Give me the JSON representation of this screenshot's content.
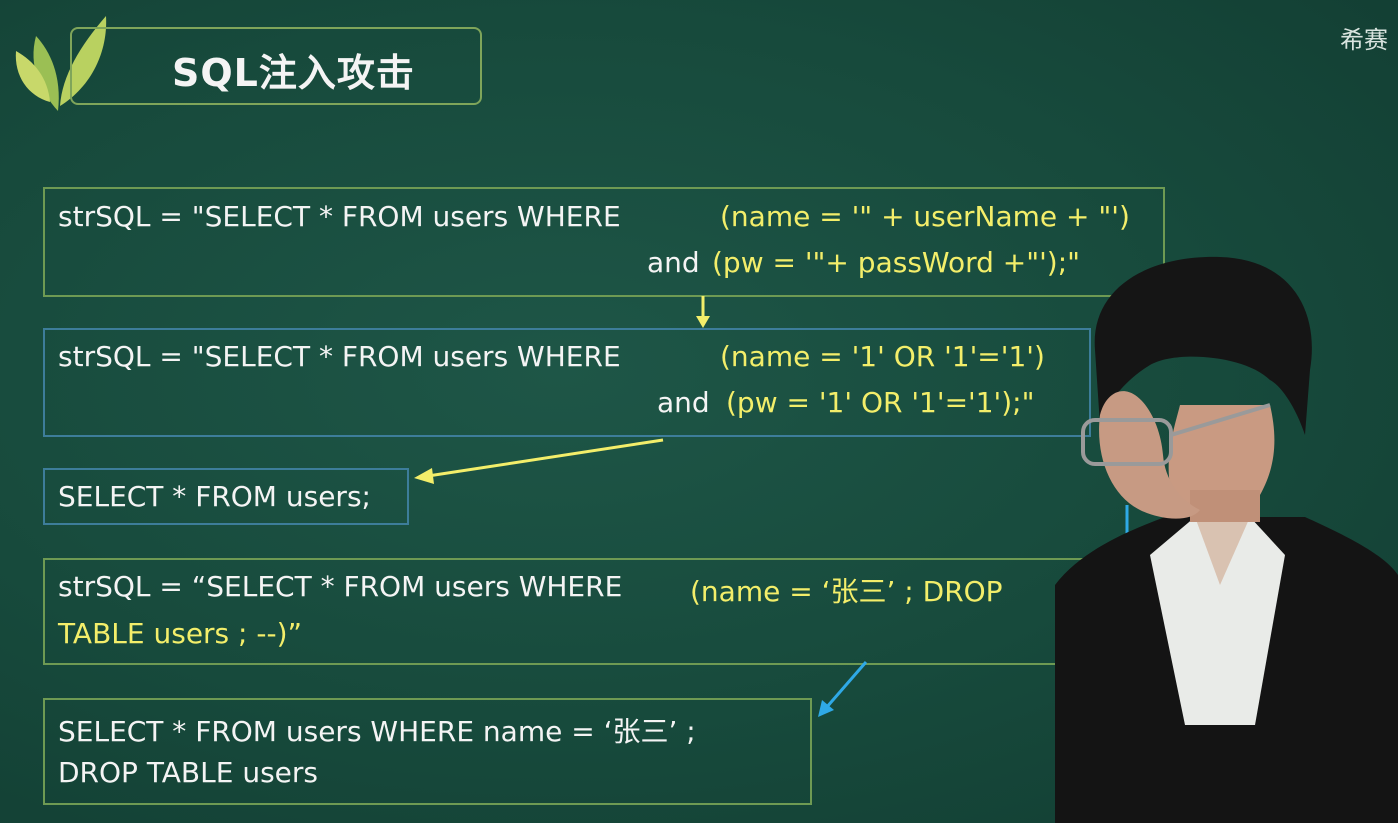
{
  "slide": {
    "title": "SQL注入攻击",
    "watermark": "希赛"
  },
  "blocks": [
    {
      "line1_left": "strSQL = \"SELECT * FROM users WHERE",
      "line1_right": "(name = '\" + userName + \"')",
      "line2_white": "and",
      "line2_yellow": "(pw = '\"+ passWord +\"');\""
    },
    {
      "line1_left": "strSQL = \"SELECT * FROM users WHERE",
      "line1_right": "(name = '1' OR '1'='1')",
      "line2_white": "and",
      "line2_yellow": "(pw = '1' OR '1'='1');\""
    },
    {
      "line1": "SELECT * FROM users;"
    },
    {
      "line1_white": "strSQL =   “SELECT * FROM users WHERE",
      "line1_yellow": "(name =   ‘张三’   ; DROP",
      "line2_yellow": "TABLE users ; --)”"
    },
    {
      "line1": "SELECT * FROM users WHERE name =   ‘张三’  ;",
      "line2": "DROP TABLE users"
    }
  ],
  "colors": {
    "background": "#174a3c",
    "highlight_yellow": "#f3ee6a",
    "arrow_blue": "#2fa9e6",
    "box_green": "#6e9a53",
    "box_blue": "#3d7d9a"
  },
  "icons": [
    "leaf-logo-icon",
    "arrow-down-icon",
    "arrow-left-icon",
    "arrow-down-left-icon"
  ]
}
